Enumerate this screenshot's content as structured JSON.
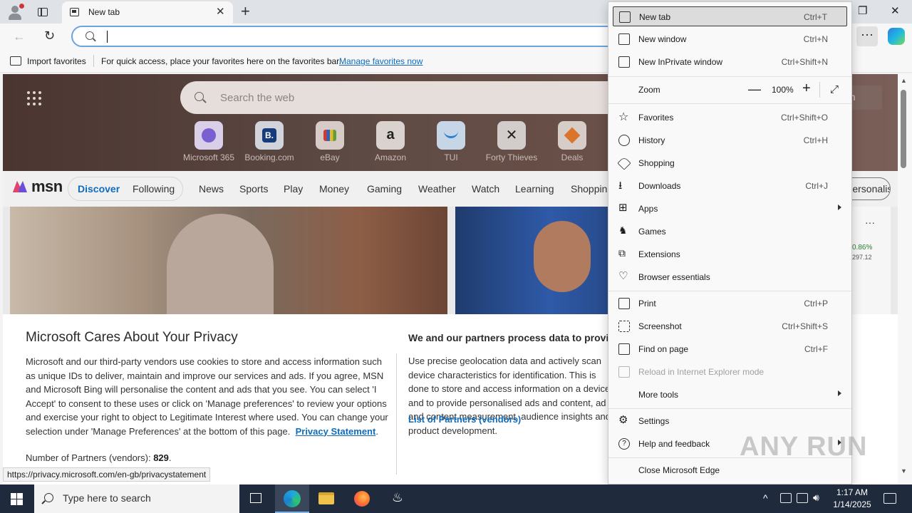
{
  "browser": {
    "tab_title": "New tab",
    "window_controls": {
      "minimize": "—",
      "restore": "❐",
      "close": "✕"
    }
  },
  "favorites_bar": {
    "import_label": "Import favorites",
    "message": "For quick access, place your favorites here on the favorites bar.",
    "manage_link": "Manage favorites now"
  },
  "newtab": {
    "search_placeholder": "Search the web",
    "signin_label": "n in",
    "quick_links": [
      {
        "label": "Microsoft 365",
        "icon": "microsoft365-icon"
      },
      {
        "label": "Booking.com",
        "icon": "booking-icon"
      },
      {
        "label": "eBay",
        "icon": "ebay-icon"
      },
      {
        "label": "Amazon",
        "icon": "amazon-icon"
      },
      {
        "label": "TUI",
        "icon": "tui-icon"
      },
      {
        "label": "Forty Thieves",
        "icon": "forty-thieves-icon"
      },
      {
        "label": "Deals",
        "icon": "deals-icon"
      }
    ]
  },
  "msn": {
    "logo": "msn",
    "discover": "Discover",
    "following": "Following",
    "nav": [
      "News",
      "Sports",
      "Play",
      "Money",
      "Gaming",
      "Weather",
      "Watch",
      "Learning",
      "Shopping"
    ],
    "personalise": "Personalise",
    "widget_pct": "0.86%",
    "widget_value": "297.12"
  },
  "privacy": {
    "title": "Microsoft Cares About Your Privacy",
    "body_part1": "Microsoft and our third-party vendors use cookies to store and access information such as unique IDs to deliver, maintain and improve our services and ads. If you agree, MSN and Microsoft Bing will personalise the content and ads that you see. You can select 'I Accept' to consent to these uses or click on 'Manage preferences' to review your options and exercise your right to object to Legitimate Interest where used.  You can change your selection under 'Manage Preferences' at the bottom of this page.",
    "privacy_link": "Privacy Statement",
    "partners_count_label": "Number of Partners (vendors):",
    "partners_count": "829",
    "heading2": "We and our partners process data to provide:",
    "body2": "Use precise geolocation data and actively scan device characteristics for identification. This is done to store and access information on a device and to provide personalised ads and content, ad and content measurement, audience insights and product development.",
    "partners_link": "List of Partners (vendors)"
  },
  "status_url": "https://privacy.microsoft.com/en-gb/privacystatement",
  "menu": {
    "new_tab": {
      "label": "New tab",
      "shortcut": "Ctrl+T"
    },
    "new_window": {
      "label": "New window",
      "shortcut": "Ctrl+N"
    },
    "new_inprivate": {
      "label": "New InPrivate window",
      "shortcut": "Ctrl+Shift+N"
    },
    "zoom": {
      "label": "Zoom",
      "value": "100%",
      "minus": "—",
      "plus": "+"
    },
    "favorites": {
      "label": "Favorites",
      "shortcut": "Ctrl+Shift+O"
    },
    "history": {
      "label": "History",
      "shortcut": "Ctrl+H"
    },
    "shopping": {
      "label": "Shopping"
    },
    "downloads": {
      "label": "Downloads",
      "shortcut": "Ctrl+J"
    },
    "apps": {
      "label": "Apps"
    },
    "games": {
      "label": "Games"
    },
    "extensions": {
      "label": "Extensions"
    },
    "browser_essentials": {
      "label": "Browser essentials"
    },
    "print": {
      "label": "Print",
      "shortcut": "Ctrl+P"
    },
    "screenshot": {
      "label": "Screenshot",
      "shortcut": "Ctrl+Shift+S"
    },
    "find_on_page": {
      "label": "Find on page",
      "shortcut": "Ctrl+F"
    },
    "reload_ie": {
      "label": "Reload in Internet Explorer mode"
    },
    "more_tools": {
      "label": "More tools"
    },
    "settings": {
      "label": "Settings"
    },
    "help": {
      "label": "Help and feedback"
    },
    "close_edge": {
      "label": "Close Microsoft Edge"
    }
  },
  "watermark": "ANY RUN",
  "taskbar": {
    "search_placeholder": "Type here to search",
    "time": "1:17 AM",
    "date": "1/14/2025"
  },
  "colors": {
    "accent": "#0f6cbd",
    "taskbar": "#1f2a3c",
    "menu_bg": "#f9f9f9"
  }
}
